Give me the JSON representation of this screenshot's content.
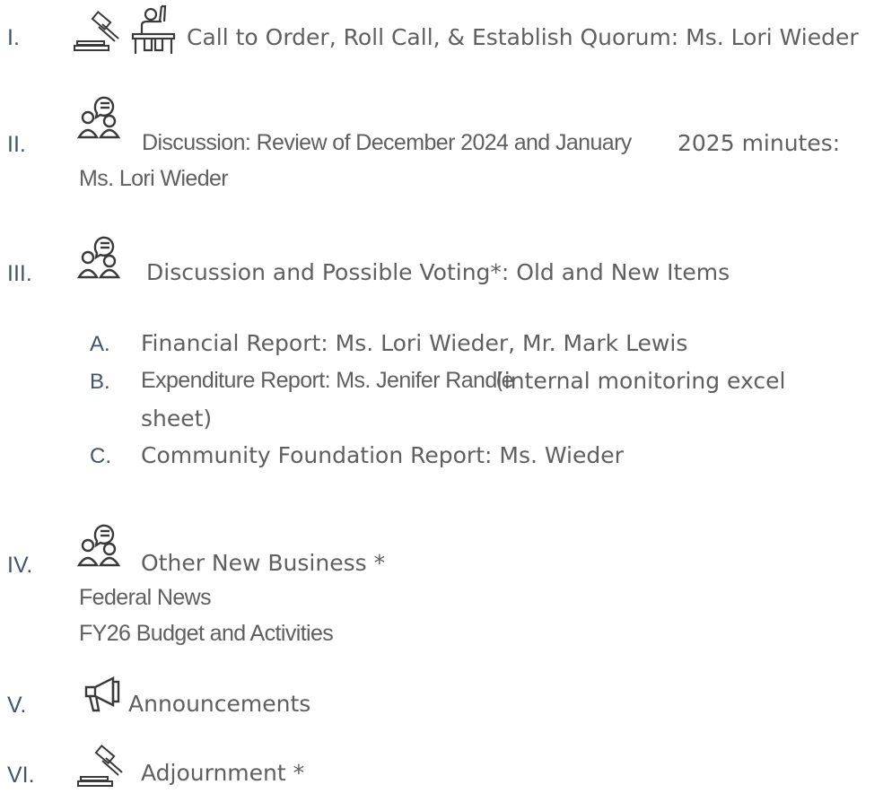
{
  "agenda": {
    "items": [
      {
        "numeral": "I.",
        "text": "Call to Order, Roll Call, & Establish Quorum: Ms. Lori Wieder"
      },
      {
        "numeral": "II.",
        "text_a": "Discussion: Review of December 2024 and January",
        "text_b": "2025 minutes:",
        "text_c": "Ms. Lori Wieder"
      },
      {
        "numeral": "III.",
        "text": "Discussion and Possible Voting*: Old and New Items",
        "subitems": [
          {
            "letter": "A.",
            "text": "Financial Report: Ms. Lori Wieder, Mr. Mark Lewis"
          },
          {
            "letter": "B.",
            "text_a": "Expenditure Report: Ms. Jenifer Randle",
            "text_b": "(internal monitoring excel",
            "text_c": "sheet)"
          },
          {
            "letter": "C.",
            "text": "Community Foundation Report: Ms. Wieder"
          }
        ]
      },
      {
        "numeral": "IV.",
        "text": "Other New Business *",
        "lines": [
          "Federal News",
          "FY26 Budget and Activities"
        ]
      },
      {
        "numeral": "V.",
        "text": "Announcements"
      },
      {
        "numeral": "VI.",
        "text": "Adjournment *"
      }
    ]
  },
  "icons": {
    "gavel": "gavel-icon",
    "raised_hand": "raised-hand-podium-icon",
    "discussion": "discussion-people-icon",
    "megaphone": "megaphone-icon"
  }
}
